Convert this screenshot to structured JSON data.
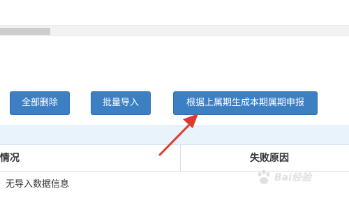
{
  "toolbar": {
    "delete_all_label": "全部删除",
    "batch_import_label": "批量导入",
    "generate_label": "根据上属期生成本期属期申报"
  },
  "table": {
    "columns": [
      "情况",
      "失败原因"
    ],
    "empty_message": "无导入数据信息"
  },
  "watermark": {
    "text": "Bai经验"
  },
  "colors": {
    "button_bg": "#3c7fc2",
    "arrow": "#e03a2f",
    "band_bg": "#e9f3fc"
  },
  "icons": {
    "arrow": "red-pointer-arrow-icon",
    "watermark": "baidu-paw-logo-icon"
  }
}
